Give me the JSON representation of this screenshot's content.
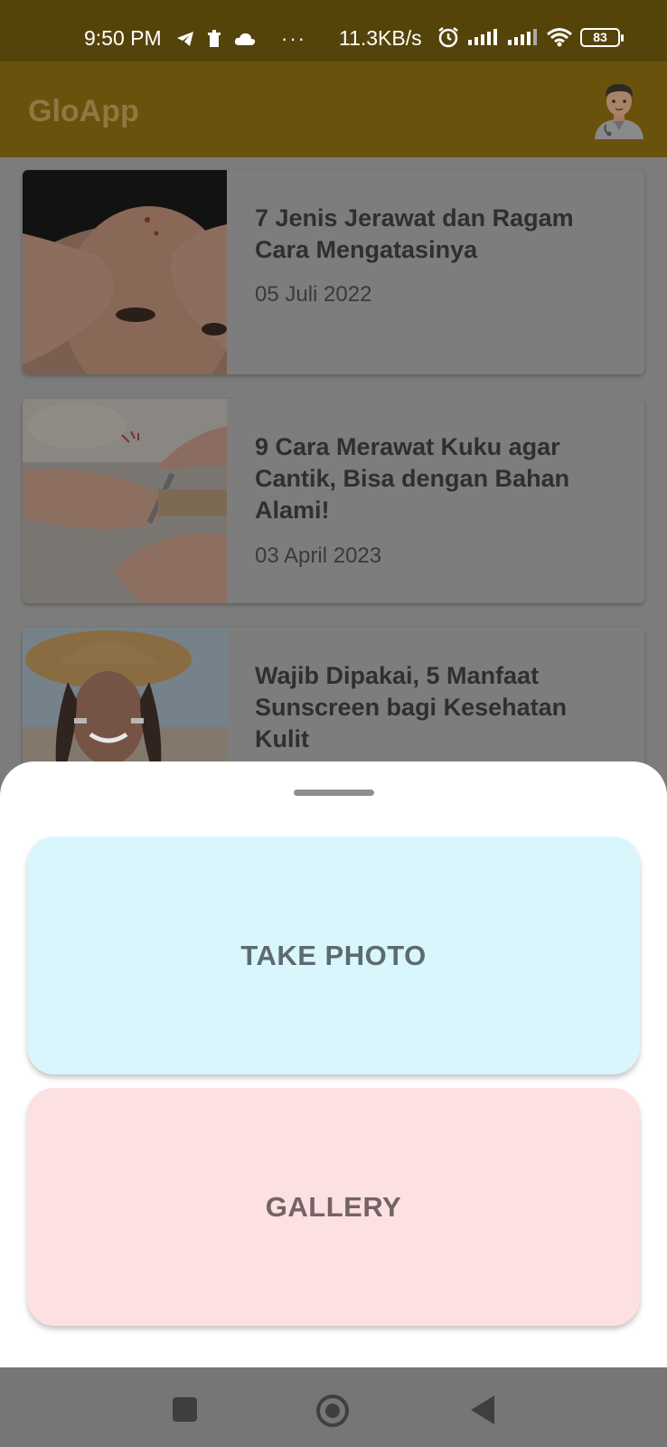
{
  "status_bar": {
    "time": "9:50 PM",
    "notif_more": "···",
    "speed": "11.3KB/s",
    "battery": "83"
  },
  "app_bar": {
    "title": "GloApp"
  },
  "articles": [
    {
      "title": "7 Jenis Jerawat dan Ragam Cara Mengatasinya",
      "date": "05 Juli 2022"
    },
    {
      "title": "9 Cara Merawat Kuku agar Cantik, Bisa dengan Bahan Alami!",
      "date": "03 April 2023"
    },
    {
      "title": "Wajib Dipakai, 5 Manfaat Sunscreen bagi Kesehatan Kulit",
      "date": ""
    }
  ],
  "sheet": {
    "take_photo_label": "TAKE PHOTO",
    "gallery_label": "GALLERY"
  },
  "colors": {
    "status_bar": "#55440a",
    "app_bar": "#6b520c",
    "take_photo_bg": "#d9f6fd",
    "gallery_bg": "#fde0e1"
  }
}
